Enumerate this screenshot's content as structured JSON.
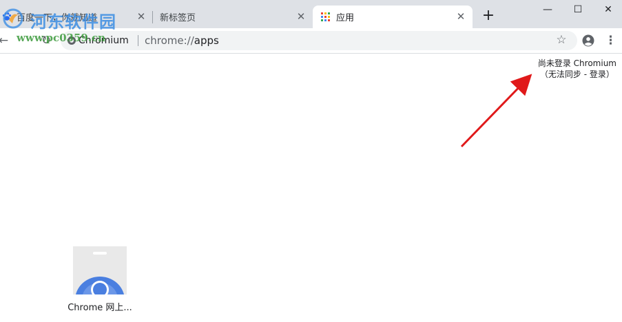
{
  "tabs": [
    {
      "title": "百度一下，你就知道",
      "icon": "baidu-paw-icon",
      "active": false
    },
    {
      "title": "新标签页",
      "icon": "",
      "active": false
    },
    {
      "title": "应用",
      "icon": "apps-grid-icon",
      "active": true
    }
  ],
  "tab_close_glyph": "✕",
  "new_tab_glyph": "+",
  "window_controls": {
    "minimize": "—",
    "maximize": "☐",
    "close": "✕"
  },
  "toolbar": {
    "back_glyph": "←",
    "reload_glyph": "↻",
    "omnibox_chip": "Chromium",
    "url_scheme": "chrome://",
    "url_host": "apps",
    "star_glyph": "☆",
    "menu_glyph": "⋮"
  },
  "watermark": {
    "site_name": "河东软件园",
    "url": "www.pc0359.cn"
  },
  "signin": {
    "line1": "尚未登录 Chromium",
    "line2_prefix": "（无法同步 - ",
    "link": "登录",
    "line2_suffix": "）"
  },
  "apps": [
    {
      "label": "Chrome 网上...",
      "icon": "chrome-web-store-icon"
    }
  ],
  "colors": {
    "tabstrip": "#dee1e6",
    "omnibox": "#f1f3f4",
    "arrow": "#e0191a",
    "store_blue": "#4a7fe0"
  }
}
